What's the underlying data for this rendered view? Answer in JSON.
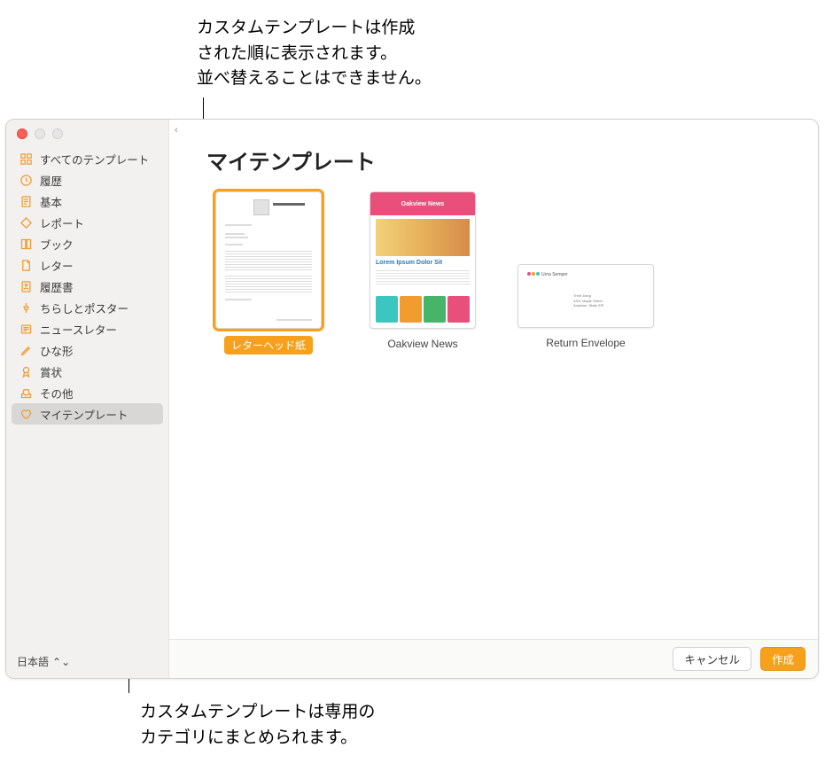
{
  "callouts": {
    "top": "カスタムテンプレートは作成\nされた順に表示されます。\n並べ替えることはできません。",
    "bottom": "カスタムテンプレートは専用の\nカテゴリにまとめられます。"
  },
  "sidebar": {
    "items": [
      {
        "label": "すべてのテンプレート",
        "icon": "grid-icon"
      },
      {
        "label": "履歴",
        "icon": "clock-icon"
      },
      {
        "label": "基本",
        "icon": "doc-icon"
      },
      {
        "label": "レポート",
        "icon": "diamond-icon"
      },
      {
        "label": "ブック",
        "icon": "book-icon"
      },
      {
        "label": "レター",
        "icon": "folded-icon"
      },
      {
        "label": "履歴書",
        "icon": "person-icon"
      },
      {
        "label": "ちらしとポスター",
        "icon": "pin-icon"
      },
      {
        "label": "ニュースレター",
        "icon": "news-icon"
      },
      {
        "label": "ひな形",
        "icon": "pencil-icon"
      },
      {
        "label": "賞状",
        "icon": "award-icon"
      },
      {
        "label": "その他",
        "icon": "tray-icon"
      },
      {
        "label": "マイテンプレート",
        "icon": "heart-icon"
      }
    ],
    "selected_index": 12
  },
  "language": {
    "label": "日本語"
  },
  "main": {
    "title": "マイテンプレート",
    "templates": [
      {
        "label": "レターヘッド紙",
        "selected": true
      },
      {
        "label": "Oakview News",
        "selected": false
      },
      {
        "label": "Return Envelope",
        "selected": false
      }
    ],
    "newsletter_preview": {
      "banner": "Oakview News",
      "headline": "Lorem Ipsum Dolor Sit"
    }
  },
  "footer": {
    "cancel": "キャンセル",
    "create": "作成"
  }
}
